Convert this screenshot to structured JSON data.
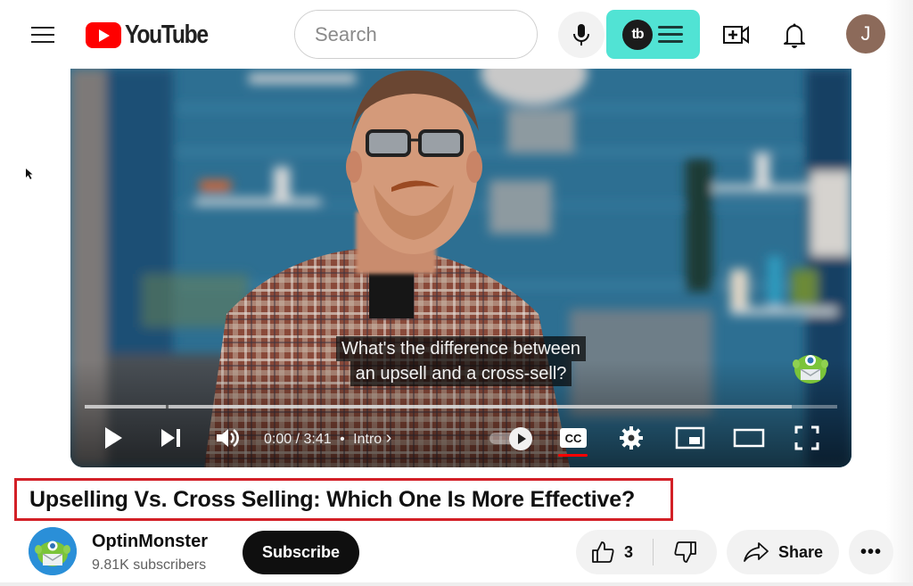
{
  "header": {
    "logo_text": "YouTube",
    "search_placeholder": "Search",
    "tubebuddy_label": "tb",
    "avatar_initial": "J",
    "icons": [
      "menu-icon",
      "youtube-logo-icon",
      "search-icon",
      "microphone-icon",
      "tubebuddy-icon",
      "create-video-icon",
      "notifications-bell-icon"
    ]
  },
  "player": {
    "captions": [
      "What's the difference between",
      "an upsell and a cross-sell?"
    ],
    "current_time": "0:00",
    "duration": "3:41",
    "time_separator": "/",
    "chapter_dot": "•",
    "chapter": "Intro",
    "chapter_chevron": "›",
    "played_fraction": 0,
    "loaded_fraction": 0.94,
    "chapter_marker_fraction": 0.108,
    "autoplay_on": true,
    "captions_on": true,
    "controls": [
      "play-icon",
      "next-icon",
      "volume-icon",
      "autoplay-toggle",
      "captions-icon",
      "settings-icon",
      "miniplayer-icon",
      "theater-mode-icon",
      "fullscreen-icon"
    ],
    "colors": {
      "progress_played": "#ff0000",
      "cc_active": "#ff0000"
    }
  },
  "video": {
    "title": "Upselling Vs. Cross Selling: Which One Is More Effective?",
    "highlight_color": "#d32027"
  },
  "channel": {
    "name": "OptinMonster",
    "subscribers": "9.81K subscribers",
    "subscribe_label": "Subscribe"
  },
  "actions": {
    "like_count": "3",
    "share_label": "Share",
    "more_label": "•••"
  }
}
